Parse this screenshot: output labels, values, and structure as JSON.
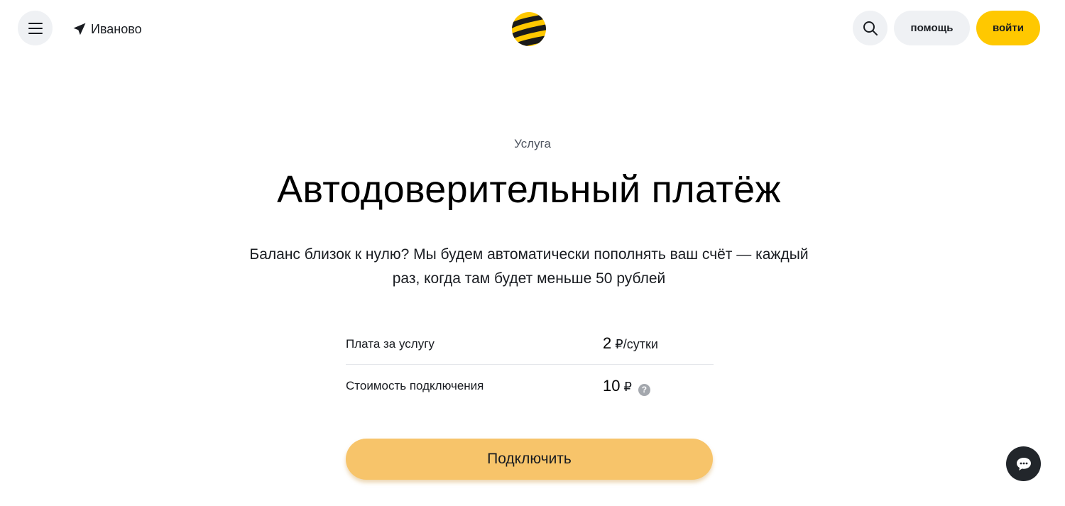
{
  "header": {
    "menu_icon": "hamburger-menu-icon",
    "city_icon": "location-arrow-icon",
    "city": "Иваново",
    "logo_icon": "beeline-logo-icon",
    "search_icon": "search-icon",
    "help_label": "помощь",
    "login_label": "войти"
  },
  "main": {
    "eyebrow": "Услуга",
    "title": "Автодоверительный платёж",
    "description": "Баланс близок к нулю? Мы будем автоматически пополнять ваш счёт — каждый раз, когда там будет меньше 50 рублей",
    "params": [
      {
        "label": "Плата за услугу",
        "value": "2",
        "unit": "₽/сутки"
      },
      {
        "label": "Стоимость подключения",
        "value": "10",
        "unit": "₽",
        "help_icon": "question-mark-icon",
        "help_glyph": "?"
      }
    ],
    "connect_label": "Подключить"
  },
  "chat": {
    "icon": "chat-bubble-icon"
  },
  "colors": {
    "accent": "#ffc800",
    "connect_button": "#f7c46a",
    "pill_bg": "#eff1f4",
    "chat_bg": "#22262b"
  }
}
